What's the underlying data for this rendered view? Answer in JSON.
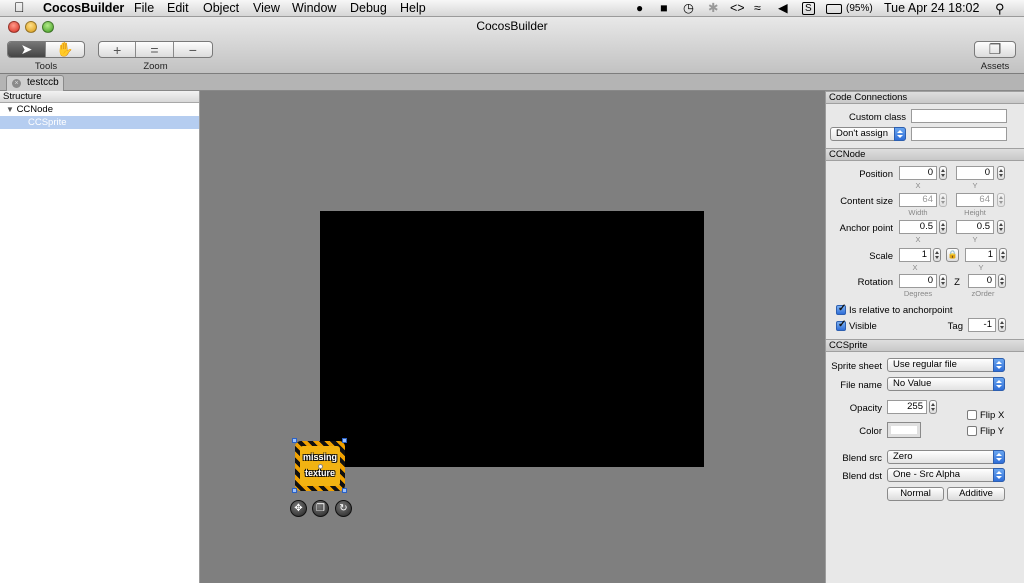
{
  "menubar": {
    "app_name": "CocosBuilder",
    "items": [
      "File",
      "Edit",
      "Object",
      "View",
      "Window",
      "Debug",
      "Help"
    ],
    "battery": "(95%)",
    "clock": "Tue Apr 24  18:02"
  },
  "window": {
    "title": "CocosBuilder",
    "tools_label": "Tools",
    "zoom_label": "Zoom",
    "assets_label": "Assets",
    "tab_label": "testccb"
  },
  "structure": {
    "header": "Structure",
    "nodes": [
      "CCNode",
      "CCSprite"
    ]
  },
  "canvas": {
    "sprite_line1": "missing",
    "sprite_line2": "texture"
  },
  "inspector": {
    "code_connections": {
      "title": "Code Connections",
      "custom_class_label": "Custom class",
      "custom_class_value": "",
      "assign_option": "Don't assign",
      "assign_value": ""
    },
    "ccnode": {
      "title": "CCNode",
      "position_label": "Position",
      "position_x": "0",
      "position_y": "0",
      "x_sub": "X",
      "y_sub": "Y",
      "content_size_label": "Content size",
      "content_w": "64",
      "content_h": "64",
      "width_sub": "Width",
      "height_sub": "Height",
      "anchor_label": "Anchor point",
      "anchor_x": "0.5",
      "anchor_y": "0.5",
      "scale_label": "Scale",
      "scale_x": "1",
      "scale_y": "1",
      "rotation_label": "Rotation",
      "rotation_value": "0",
      "degrees_sub": "Degrees",
      "z_label": "Z",
      "zorder_value": "0",
      "zorder_sub": "zOrder",
      "relative_label": "Is relative to anchorpoint",
      "visible_label": "Visible",
      "tag_label": "Tag",
      "tag_value": "-1"
    },
    "ccsprite": {
      "title": "CCSprite",
      "sprite_sheet_label": "Sprite sheet",
      "sprite_sheet_value": "Use regular file",
      "file_name_label": "File name",
      "file_name_value": "No Value",
      "opacity_label": "Opacity",
      "opacity_value": "255",
      "color_label": "Color",
      "flip_x_label": "Flip X",
      "flip_y_label": "Flip Y",
      "blend_src_label": "Blend src",
      "blend_src_value": "Zero",
      "blend_dst_label": "Blend dst",
      "blend_dst_value": "One - Src Alpha",
      "normal_label": "Normal",
      "additive_label": "Additive"
    }
  },
  "colors": {
    "selection": "#b5cdf0",
    "canvas_bg": "#7f7f7f",
    "stage": "#000000"
  }
}
